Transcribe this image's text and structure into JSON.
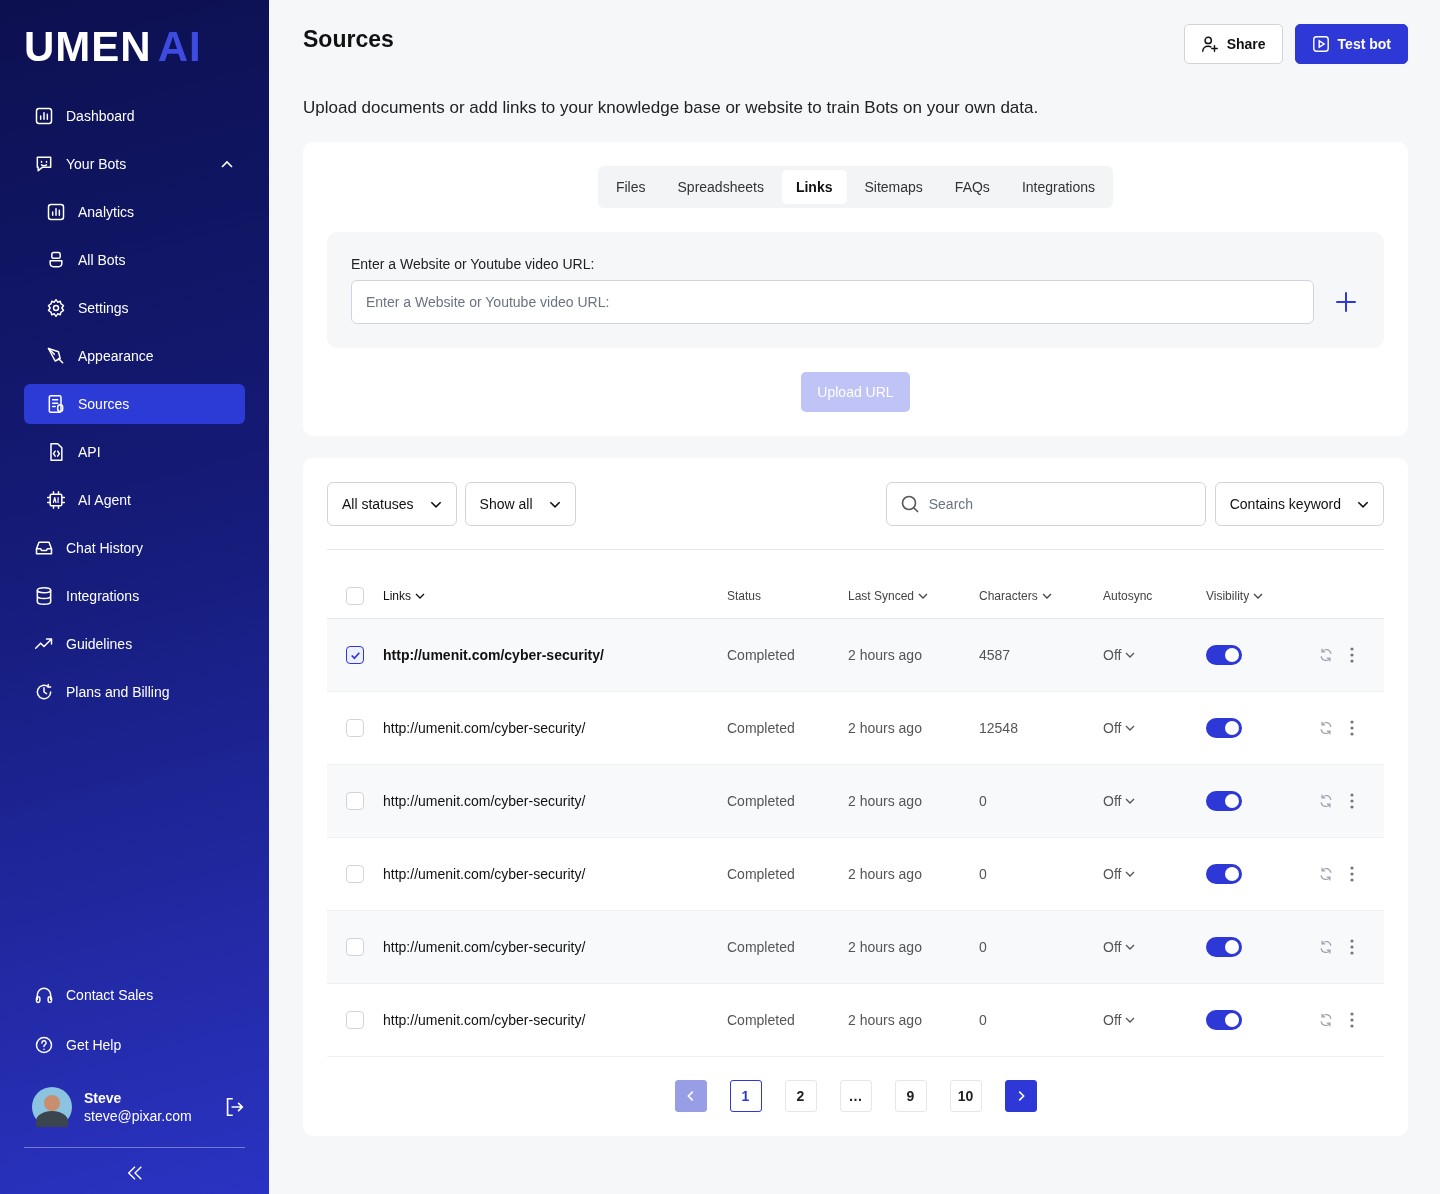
{
  "sidebar": {
    "logo": {
      "main": "UMEN",
      "accent": "AI"
    },
    "nav": [
      {
        "label": "Dashboard",
        "selected": false
      },
      {
        "label": "Your Bots",
        "selected": false,
        "expanded": true,
        "children": [
          {
            "label": "Analytics",
            "selected": false
          },
          {
            "label": "All Bots",
            "selected": false
          },
          {
            "label": "Settings",
            "selected": false
          },
          {
            "label": "Appearance",
            "selected": false
          },
          {
            "label": "Sources",
            "selected": true
          },
          {
            "label": "API",
            "selected": false
          },
          {
            "label": "AI Agent",
            "selected": false
          }
        ]
      },
      {
        "label": "Chat History",
        "selected": false
      },
      {
        "label": "Integrations",
        "selected": false
      },
      {
        "label": "Guidelines",
        "selected": false
      },
      {
        "label": "Plans and Billing",
        "selected": false
      }
    ],
    "footer": [
      {
        "label": "Contact Sales"
      },
      {
        "label": "Get Help"
      }
    ],
    "user": {
      "name": "Steve",
      "email": "steve@pixar.com"
    }
  },
  "header": {
    "title": "Sources",
    "buttons": [
      {
        "label": "Share",
        "kind": "secondary"
      },
      {
        "label": "Test bot",
        "kind": "primary"
      }
    ]
  },
  "description": "Upload documents or add links to your knowledge base or website to train Bots on your own data.",
  "tabs": [
    {
      "label": "Files",
      "selected": false
    },
    {
      "label": "Spreadsheets",
      "selected": false
    },
    {
      "label": "Links",
      "selected": true
    },
    {
      "label": "Sitemaps",
      "selected": false
    },
    {
      "label": "FAQs",
      "selected": false
    },
    {
      "label": "Integrations",
      "selected": false
    }
  ],
  "url_form": {
    "label": "Enter a Website or Youtube video URL:",
    "placeholder": "Enter a Website or Youtube video URL:",
    "submit": {
      "label": "Upload URL",
      "disabled": true
    }
  },
  "filters": {
    "dropdowns": [
      "All statuses",
      "Show all"
    ],
    "search": {
      "placeholder": "Search"
    },
    "match": "Contains keyword"
  },
  "table": {
    "all_checked": false,
    "columns": [
      {
        "label": "Links",
        "sortable": true
      },
      {
        "label": "Status",
        "sortable": false
      },
      {
        "label": "Last Synced",
        "sortable": true
      },
      {
        "label": "Characters",
        "sortable": true
      },
      {
        "label": "Autosync",
        "sortable": false
      },
      {
        "label": "Visibility",
        "sortable": true
      }
    ],
    "rows": [
      {
        "checked": true,
        "url": "http://umenit.com/cyber-security/",
        "status": "Completed",
        "last_synced": "2 hours ago",
        "characters": "4587",
        "autosync": "Off",
        "visible": true
      },
      {
        "checked": false,
        "url": "http://umenit.com/cyber-security/",
        "status": "Completed",
        "last_synced": "2 hours ago",
        "characters": "12548",
        "autosync": "Off",
        "visible": true
      },
      {
        "checked": false,
        "url": "http://umenit.com/cyber-security/",
        "status": "Completed",
        "last_synced": "2 hours ago",
        "characters": "0",
        "autosync": "Off",
        "visible": true
      },
      {
        "checked": false,
        "url": "http://umenit.com/cyber-security/",
        "status": "Completed",
        "last_synced": "2 hours ago",
        "characters": "0",
        "autosync": "Off",
        "visible": true
      },
      {
        "checked": false,
        "url": "http://umenit.com/cyber-security/",
        "status": "Completed",
        "last_synced": "2 hours ago",
        "characters": "0",
        "autosync": "Off",
        "visible": true
      },
      {
        "checked": false,
        "url": "http://umenit.com/cyber-security/",
        "status": "Completed",
        "last_synced": "2 hours ago",
        "characters": "0",
        "autosync": "Off",
        "visible": true
      }
    ]
  },
  "pagination": {
    "prev_disabled": true,
    "next_disabled": false,
    "pages": [
      {
        "label": "1",
        "selected": true
      },
      {
        "label": "2",
        "selected": false
      },
      {
        "label": "…",
        "selected": false
      },
      {
        "label": "9",
        "selected": false
      },
      {
        "label": "10",
        "selected": false
      }
    ]
  }
}
